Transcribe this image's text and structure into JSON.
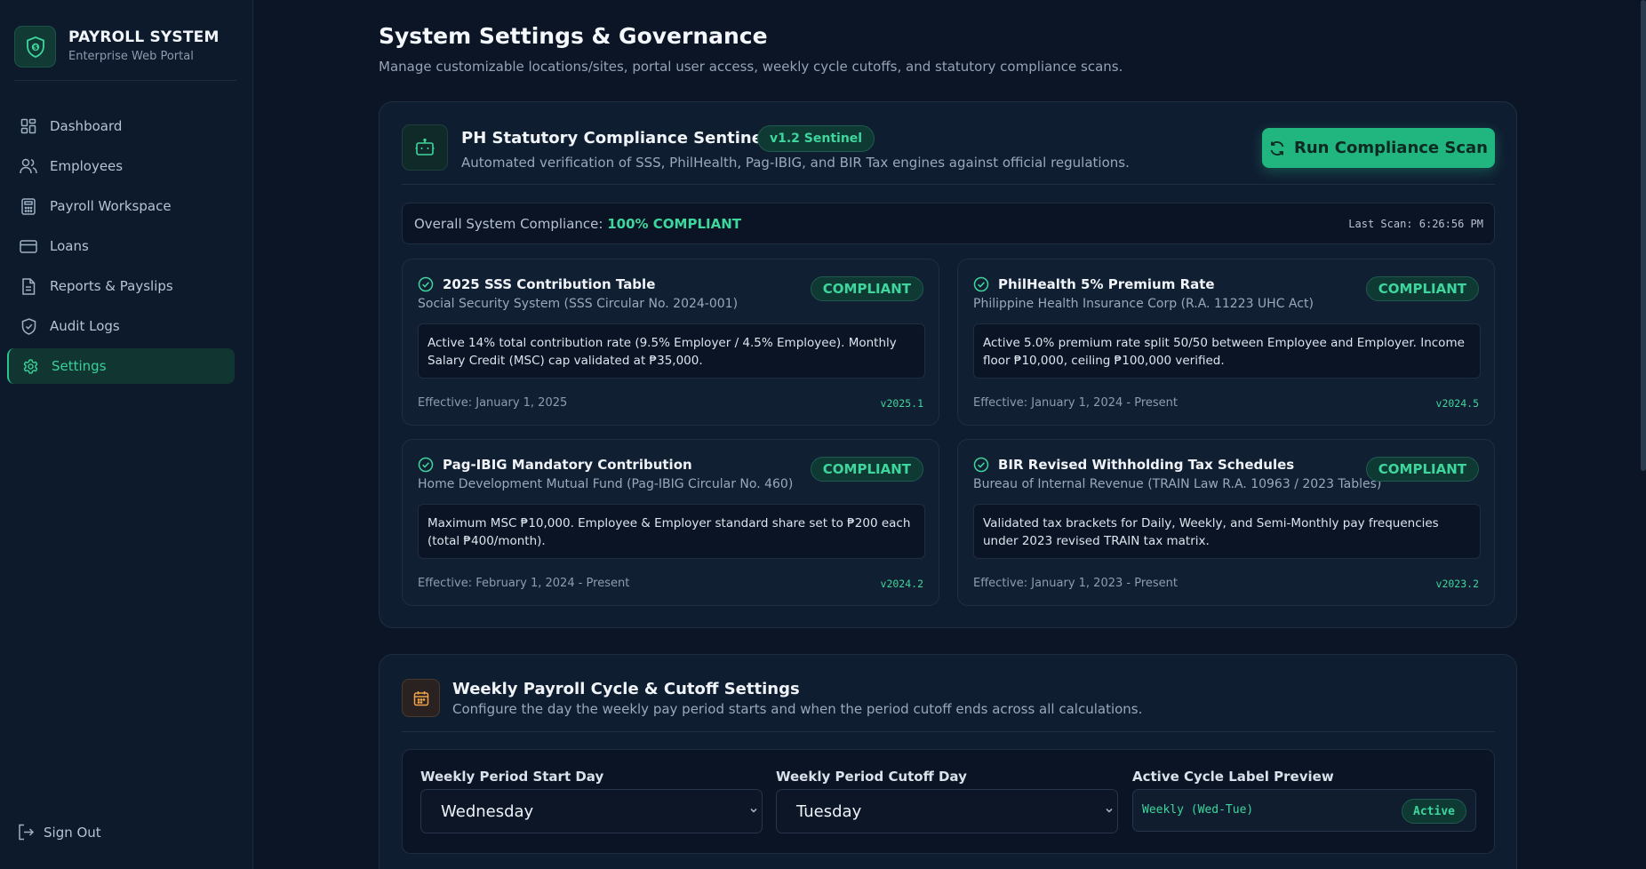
{
  "brand": {
    "title": "PAYROLL SYSTEM",
    "subtitle": "Enterprise Web Portal"
  },
  "nav": {
    "items": [
      {
        "label": "Dashboard",
        "icon": "dashboard-icon"
      },
      {
        "label": "Employees",
        "icon": "users-icon"
      },
      {
        "label": "Payroll Workspace",
        "icon": "calculator-icon"
      },
      {
        "label": "Loans",
        "icon": "credit-card-icon"
      },
      {
        "label": "Reports & Payslips",
        "icon": "document-icon"
      },
      {
        "label": "Audit Logs",
        "icon": "shield-check-icon"
      },
      {
        "label": "Settings",
        "icon": "gear-icon",
        "active": true
      }
    ],
    "sign_out": "Sign Out"
  },
  "page": {
    "title": "System Settings & Governance",
    "subtitle": "Manage customizable locations/sites, portal user access, weekly cycle cutoffs, and statutory compliance scans."
  },
  "compliance": {
    "title": "PH Statutory Compliance Sentinel Bot",
    "version": "v1.2 Sentinel",
    "description": "Automated verification of SSS, PhilHealth, Pag-IBIG, and BIR Tax engines against official regulations.",
    "scan_button": "Run Compliance Scan",
    "overall_label": "Overall System Compliance:",
    "overall_value": "100% COMPLIANT",
    "last_scan": "Last Scan: 6:26:56 PM",
    "cards": [
      {
        "title": "2025 SSS Contribution Table",
        "org": "Social Security System (SSS Circular No. 2024-001)",
        "status": "COMPLIANT",
        "description": "Active 14% total contribution rate (9.5% Employer / 4.5% Employee). Monthly Salary Credit (MSC) cap validated at ₱35,000.",
        "effective": "Effective: January 1, 2025",
        "version": "v2025.1"
      },
      {
        "title": "PhilHealth 5% Premium Rate",
        "org": "Philippine Health Insurance Corp (R.A. 11223 UHC Act)",
        "status": "COMPLIANT",
        "description": "Active 5.0% premium rate split 50/50 between Employee and Employer. Income floor ₱10,000, ceiling ₱100,000 verified.",
        "effective": "Effective: January 1, 2024 - Present",
        "version": "v2024.5"
      },
      {
        "title": "Pag-IBIG Mandatory Contribution",
        "org": "Home Development Mutual Fund (Pag-IBIG Circular No. 460)",
        "status": "COMPLIANT",
        "description": "Maximum MSC ₱10,000. Employee & Employer standard share set to ₱200 each (total ₱400/month).",
        "effective": "Effective: February 1, 2024 - Present",
        "version": "v2024.2"
      },
      {
        "title": "BIR Revised Withholding Tax Schedules",
        "org": "Bureau of Internal Revenue (TRAIN Law R.A. 10963 / 2023 Tables)",
        "status": "COMPLIANT",
        "description": "Validated tax brackets for Daily, Weekly, and Semi-Monthly pay frequencies under 2023 revised TRAIN tax matrix.",
        "effective": "Effective: January 1, 2023 - Present",
        "version": "v2023.2"
      }
    ]
  },
  "cycle": {
    "title": "Weekly Payroll Cycle & Cutoff Settings",
    "description": "Configure the day the weekly pay period starts and when the period cutoff ends across all calculations.",
    "start_label": "Weekly Period Start Day",
    "start_value": "Wednesday",
    "cutoff_label": "Weekly Period Cutoff Day",
    "cutoff_value": "Tuesday",
    "preview_label": "Active Cycle Label Preview",
    "preview_value": "Weekly (Wed-Tue)",
    "preview_status": "Active"
  },
  "colors": {
    "accent": "#3ed69c",
    "background": "#0b1526",
    "panel": "#0f1d31"
  }
}
